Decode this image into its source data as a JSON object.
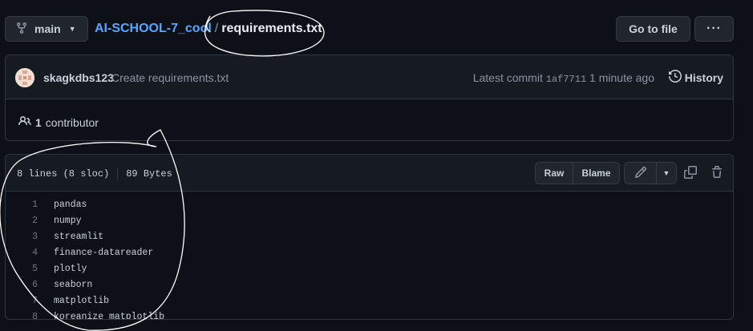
{
  "topbar": {
    "branch": "main",
    "repo": "AI-SCHOOL-7_cool",
    "separator": "/",
    "file": "requirements.txt",
    "goto_label": "Go to file",
    "more_label": "···"
  },
  "commit": {
    "author": "skagkdbs123",
    "message": "Create requirements.txt",
    "latest_prefix": "Latest commit",
    "sha": "1af7711",
    "time": "1 minute ago",
    "history_label": "History"
  },
  "contributors": {
    "count": "1",
    "label": "contributor"
  },
  "file": {
    "lines_info": "8 lines (8 sloc)",
    "size": "89 Bytes",
    "raw_label": "Raw",
    "blame_label": "Blame"
  },
  "code_lines": [
    {
      "num": "1",
      "text": "pandas"
    },
    {
      "num": "2",
      "text": "numpy"
    },
    {
      "num": "3",
      "text": "streamlit"
    },
    {
      "num": "4",
      "text": "finance-datareader"
    },
    {
      "num": "5",
      "text": "plotly"
    },
    {
      "num": "6",
      "text": "seaborn"
    },
    {
      "num": "7",
      "text": "matplotlib"
    },
    {
      "num": "8",
      "text": "koreanize_matplotlib"
    }
  ],
  "colors": {
    "background": "#0d1117",
    "link": "#58a6ff",
    "muted": "#8b949e"
  }
}
